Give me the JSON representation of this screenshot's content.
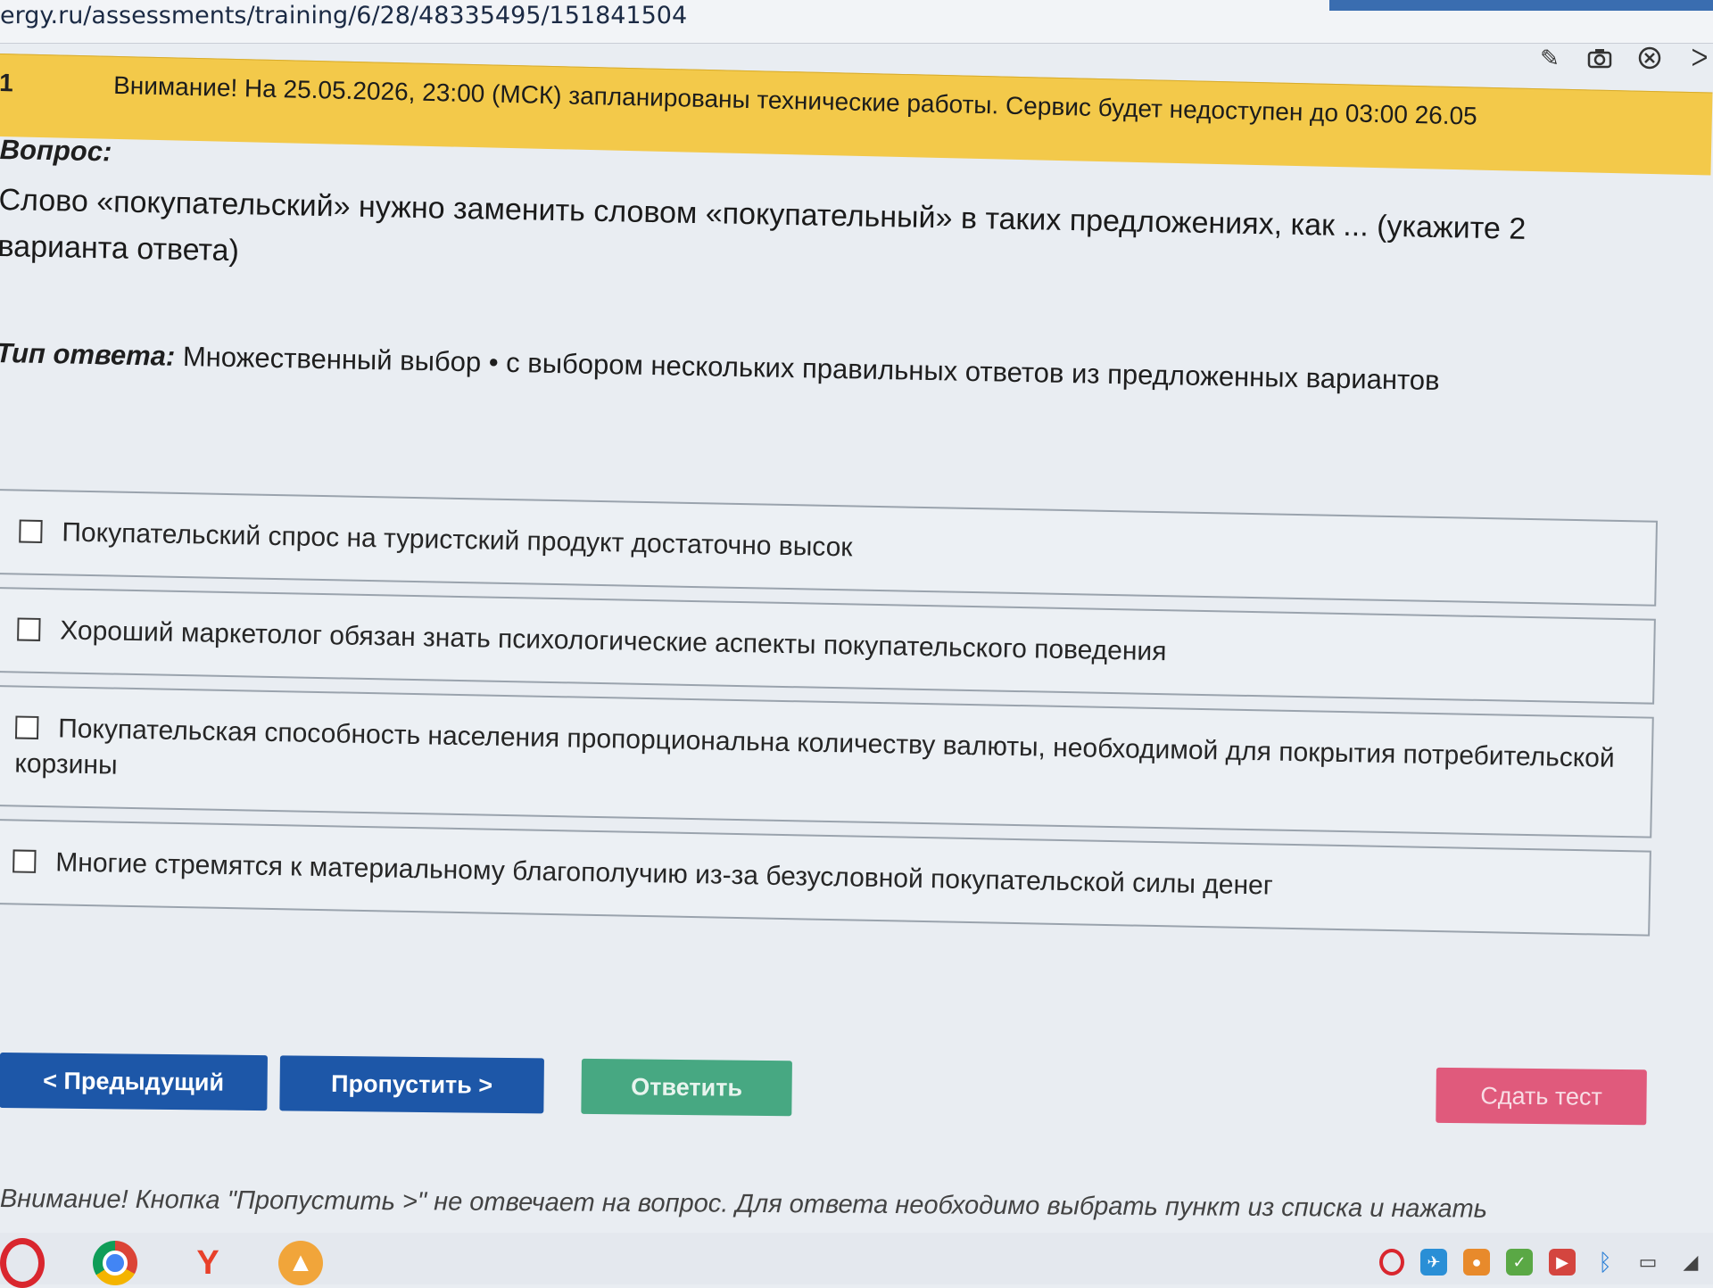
{
  "browser": {
    "url": "ergy.ru/assessments/training/6/28/48335495/151841504"
  },
  "notice": {
    "number": "1",
    "text": "Внимание! На 25.05.2026, 23:00 (МСК) запланированы технические работы. Сервис будет недоступен до 03:00 26.05"
  },
  "toolbar": {
    "icons": [
      "edit-icon",
      "camera-icon",
      "close-circle-icon",
      "expand-icon"
    ]
  },
  "question": {
    "label": "Вопрос:",
    "text": "Слово «покупательский» нужно заменить словом «покупательный» в таких предложениях, как ... (укажите 2 варианта ответа)"
  },
  "answer_type": {
    "label": "Тип ответа:",
    "value": "Множественный выбор • с выбором нескольких правильных ответов из предложенных вариантов"
  },
  "options": [
    {
      "text": "Покупательский спрос на туристский продукт достаточно высок"
    },
    {
      "text": "Хороший маркетолог обязан знать психологические аспекты покупательского поведения"
    },
    {
      "text": "Покупательская способность населения пропорциональна количеству валюты, необходимой для покрытия потребительской корзины"
    },
    {
      "text": "Многие стремятся к материальному благополучию из-за безусловной покупательской силы денег"
    }
  ],
  "buttons": {
    "prev": "< Предыдущий",
    "skip": "Пропустить >",
    "answer": "Ответить",
    "submit": "Сдать тест"
  },
  "bottom_note": "Внимание! Кнопка \"Пропустить >\" не отвечает на вопрос. Для ответа необходимо выбрать пункт из списка и нажать",
  "colors": {
    "notice_bg": "#f3c94a",
    "primary_button": "#1d57a8",
    "answer_button": "#47a882",
    "submit_button": "#e05a7c"
  },
  "taskbar": {
    "apps": [
      "opera-icon",
      "chrome-icon",
      "yandex-icon",
      "app-icon"
    ]
  }
}
